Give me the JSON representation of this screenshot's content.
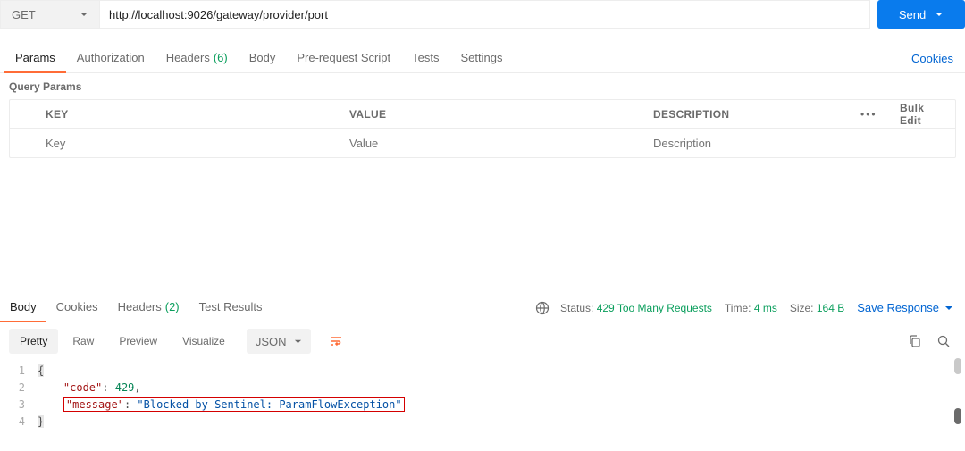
{
  "request": {
    "method": "GET",
    "url": "http://localhost:9026/gateway/provider/port",
    "send_label": "Send"
  },
  "req_tabs": {
    "params": "Params",
    "authorization": "Authorization",
    "headers": "Headers",
    "headers_count": "(6)",
    "body": "Body",
    "prerequest": "Pre-request Script",
    "tests": "Tests",
    "settings": "Settings",
    "cookies": "Cookies"
  },
  "query": {
    "title": "Query Params",
    "col_key": "KEY",
    "col_value": "VALUE",
    "col_desc": "DESCRIPTION",
    "bulk": "Bulk Edit",
    "placeholders": {
      "key": "Key",
      "value": "Value",
      "desc": "Description"
    }
  },
  "resp_tabs": {
    "body": "Body",
    "cookies": "Cookies",
    "headers": "Headers",
    "headers_count": "(2)",
    "test_results": "Test Results"
  },
  "status": {
    "status_label": "Status:",
    "status_value": "429 Too Many Requests",
    "time_label": "Time:",
    "time_value": "4 ms",
    "size_label": "Size:",
    "size_value": "164 B",
    "save": "Save Response"
  },
  "view": {
    "pretty": "Pretty",
    "raw": "Raw",
    "preview": "Preview",
    "visualize": "Visualize",
    "lang": "JSON"
  },
  "code": {
    "l1_brace_open": "{",
    "l2_indent": "    ",
    "l2_key": "\"code\"",
    "l2_colon": ": ",
    "l2_val": "429",
    "l2_comma": ",",
    "l3_indent": "    ",
    "l3_key": "\"message\"",
    "l3_colon": ": ",
    "l3_val": "\"Blocked by Sentinel: ParamFlowException\"",
    "l4_brace_close": "}"
  }
}
